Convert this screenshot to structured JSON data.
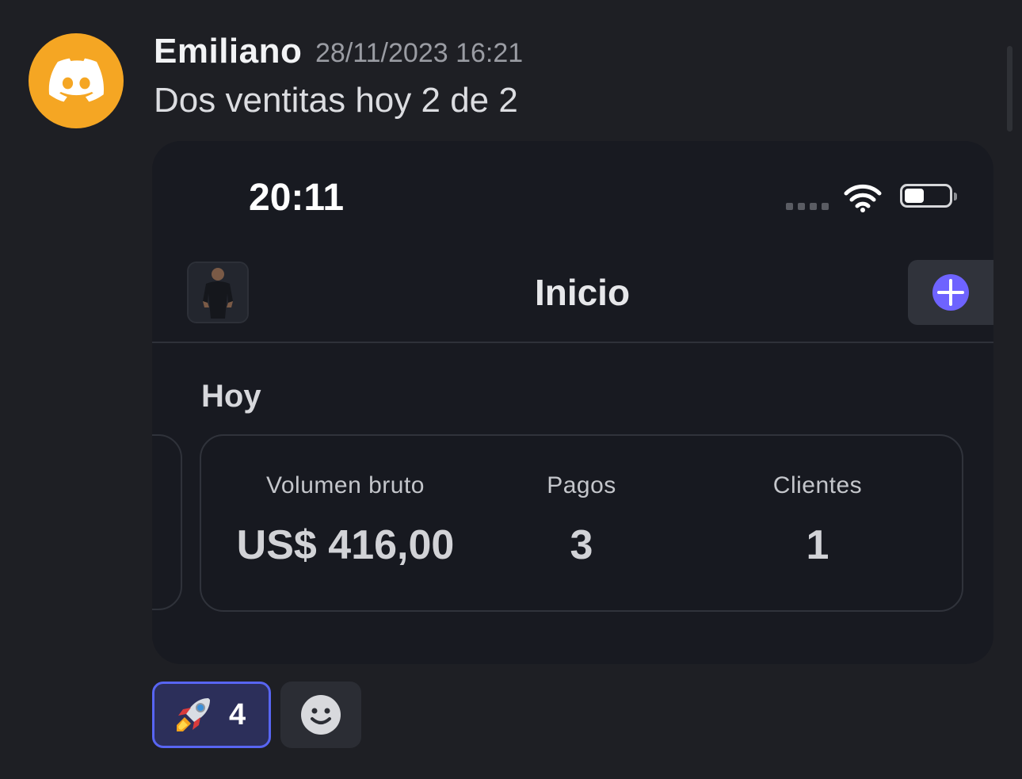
{
  "message": {
    "author": "Emiliano",
    "timestamp": "28/11/2023 16:21",
    "text": "Dos ventitas hoy 2 de 2",
    "avatar_icon": "discord-logo-icon",
    "avatar_color": "#f5a623"
  },
  "screenshot": {
    "status_bar": {
      "time": "20:11",
      "icons": [
        "signal-dots-icon",
        "wifi-icon",
        "battery-icon"
      ]
    },
    "nav": {
      "title": "Inicio",
      "add_icon": "plus-circle-icon",
      "accent": "#6e63ff"
    },
    "section_title": "Hoy",
    "stats": [
      {
        "label": "Volumen bruto",
        "value": "US$ 416,00"
      },
      {
        "label": "Pagos",
        "value": "3"
      },
      {
        "label": "Clientes",
        "value": "1"
      }
    ]
  },
  "reactions": [
    {
      "emoji": "rocket-icon",
      "count": "4",
      "active_color": "#5865f2"
    }
  ],
  "add_reaction_icon": "smiley-add-reaction-icon"
}
